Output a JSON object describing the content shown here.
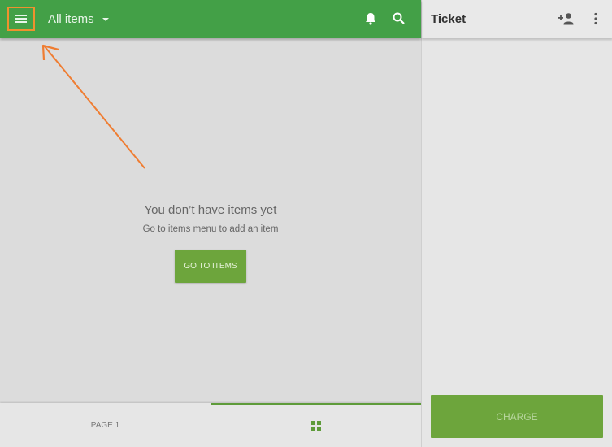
{
  "appbar": {
    "menu_icon": "menu-icon",
    "title": "All items",
    "dropdown_icon": "caret-down-icon",
    "notification_icon": "bell-icon",
    "search_icon": "search-icon"
  },
  "empty_state": {
    "title": "You don’t have items yet",
    "subtitle": "Go to items menu to add an item",
    "button_label": "GO TO ITEMS"
  },
  "bottom_tabs": [
    {
      "label": "PAGE 1",
      "active": false
    },
    {
      "icon": "grid-icon",
      "active": true
    }
  ],
  "ticket": {
    "title": "Ticket",
    "add_customer_icon": "add-person-icon",
    "more_icon": "more-vert-icon",
    "charge_label": "CHARGE"
  },
  "annotation": {
    "highlight_color": "#f0912e",
    "arrow_color": "#ef7d32"
  },
  "colors": {
    "primary": "#43a047",
    "button": "#6da53c"
  }
}
